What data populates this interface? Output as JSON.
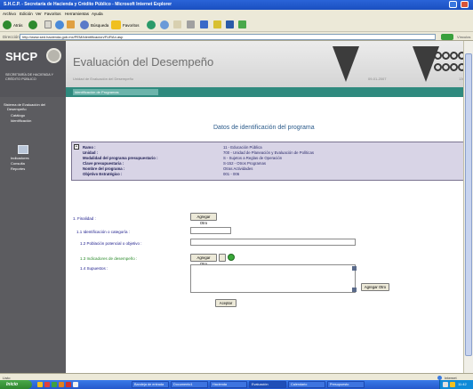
{
  "window": {
    "title": "S.H.C.P. - Secretaría de Hacienda y Crédito Público - Microsoft Internet Explorer",
    "menu": [
      "Archivo",
      "Edición",
      "Ver",
      "Favoritos",
      "Herramientas",
      "Ayuda"
    ],
    "toolbar": {
      "back": "Atrás",
      "search": "Búsqueda",
      "favorites": "Favoritos"
    },
    "address_label": "Dirección",
    "address_url": "http://www.sed.hacienda.gob.mx/PEM/identificacion/FURAn.asp",
    "go_label": "Ir",
    "links_label": "Vínculos"
  },
  "header": {
    "logo_text": "SHCP",
    "logo_subtitle": "SECRETARÍA DE HACIENDA Y CRÉDITO PÚBLICO",
    "app_title": "Evaluación del Desempeño",
    "subtitle": "Unidad de Evaluación del Desempeño",
    "date": "09-01-2007",
    "page_num": "1306",
    "breadcrumb": "Identificación de Programas"
  },
  "sidebar": {
    "items": [
      "Sistema de Evaluación del",
      "Desempeño",
      "Catálogo",
      "Identificación",
      "Indicadores",
      "Consulta",
      "Reportes"
    ]
  },
  "main": {
    "heading": "Datos de identificación del programa",
    "info": [
      {
        "key": "Ramo :",
        "value": "11 - Educación Pública"
      },
      {
        "key": "Unidad :",
        "value": "700 - Unidad de Planeación y Evaluación de Políticas"
      },
      {
        "key": "Modalidad del programa presupuestario :",
        "value": "S - Sujetos a Reglas de Operación"
      },
      {
        "key": "Clave presupuestaria :",
        "value": "S-152 - Otros Programas"
      },
      {
        "key": "Nombre del programa :",
        "value": "Otras Actividades"
      },
      {
        "key": "Objetivo Estratégico :",
        "value": "001 - 006"
      }
    ],
    "form": {
      "field1_label": "1. Finalidad :",
      "add_button": "Agregar Otro",
      "field2_label": "1.1 Identificación o categoría :",
      "field3_label": "1.2 Población potencial o objetivo :",
      "field4_label": "1.3 Indicadores de desempeño :",
      "add_button_2": "Agregar Otro",
      "field5_label": "1.4 Supuestos :",
      "add_button_3": "Agregar Otro",
      "accept_button": "Aceptar"
    }
  },
  "status": {
    "text": "Listo",
    "zone": "Internet"
  },
  "taskbar": {
    "start": "Inicio",
    "tasks": [
      "Bandeja de entrada",
      "Documento1",
      "Hacienda",
      "Evaluación",
      "Calendario",
      "Presupuesto"
    ],
    "clock": "11:42"
  }
}
